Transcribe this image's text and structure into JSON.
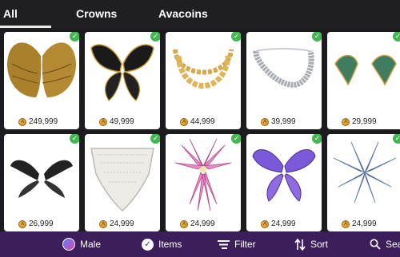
{
  "tabs": [
    {
      "label": "All",
      "selected": true
    },
    {
      "label": "Crowns",
      "selected": false
    },
    {
      "label": "Avacoins",
      "selected": false
    }
  ],
  "currency_icon": "avacoin-icon",
  "owned_icon": "check-icon",
  "items": [
    {
      "name": "golden-feather-wings",
      "price": "249,999"
    },
    {
      "name": "black-gold-butterfly-wings",
      "price": "49,999"
    },
    {
      "name": "gold-chain-necklace",
      "price": "44,999"
    },
    {
      "name": "silver-chain-necklace",
      "price": "39,999"
    },
    {
      "name": "green-gold-wing-earrings",
      "price": "29,999"
    },
    {
      "name": "black-mini-wings",
      "price": "26,999"
    },
    {
      "name": "white-lace-collar",
      "price": "24,999"
    },
    {
      "name": "pink-petal-wings",
      "price": "24,999"
    },
    {
      "name": "purple-fairy-wings",
      "price": "24,999"
    },
    {
      "name": "black-crystal-wings",
      "price": "24,999"
    }
  ],
  "bottom_bar": {
    "male_label": "Male",
    "items_label": "Items",
    "filter_label": "Filter",
    "sort_label": "Sort",
    "search_label": "Sear"
  },
  "colors": {
    "background": "#1c1b1f",
    "bottom_bar": "#3c1f5a",
    "owned_check": "#46b553",
    "coin": "#e3a236"
  }
}
